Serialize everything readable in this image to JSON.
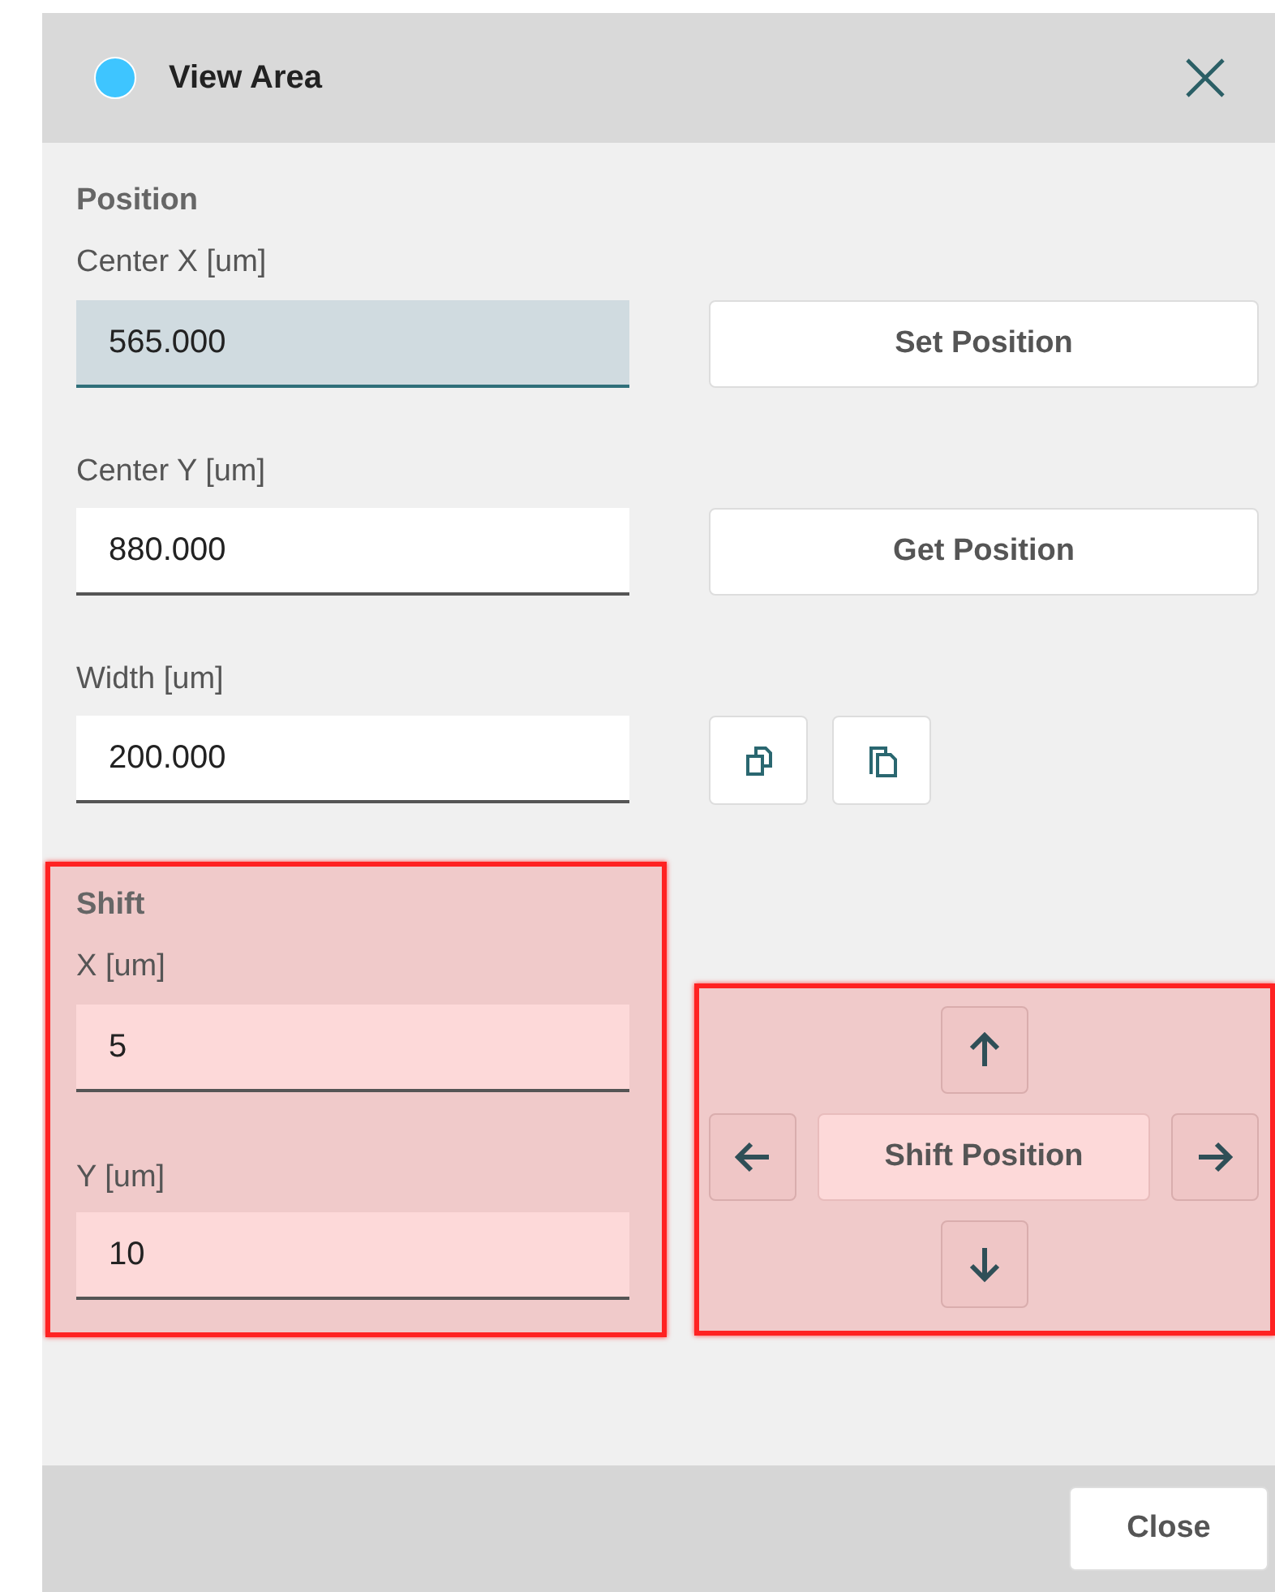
{
  "dialog": {
    "title": "View Area"
  },
  "position": {
    "heading": "Position",
    "fields": [
      {
        "label": "Center X [um]",
        "value": "565.000",
        "focused": true
      },
      {
        "label": "Center Y [um]",
        "value": "880.000",
        "focused": false
      },
      {
        "label": "Width [um]",
        "value": "200.000",
        "focused": false
      }
    ]
  },
  "position_buttons": [
    "Set Position",
    "Get Position"
  ],
  "shift": {
    "heading": "Shift",
    "highlighted": true,
    "fields": [
      {
        "label": "X [um]",
        "value": "5",
        "focused": false
      },
      {
        "label": "Y [um]",
        "value": "10",
        "focused": false
      }
    ]
  },
  "shift_pad": {
    "highlighted": true,
    "label": "Shift Position"
  },
  "footer": {
    "buttons": [
      "Close"
    ]
  }
}
